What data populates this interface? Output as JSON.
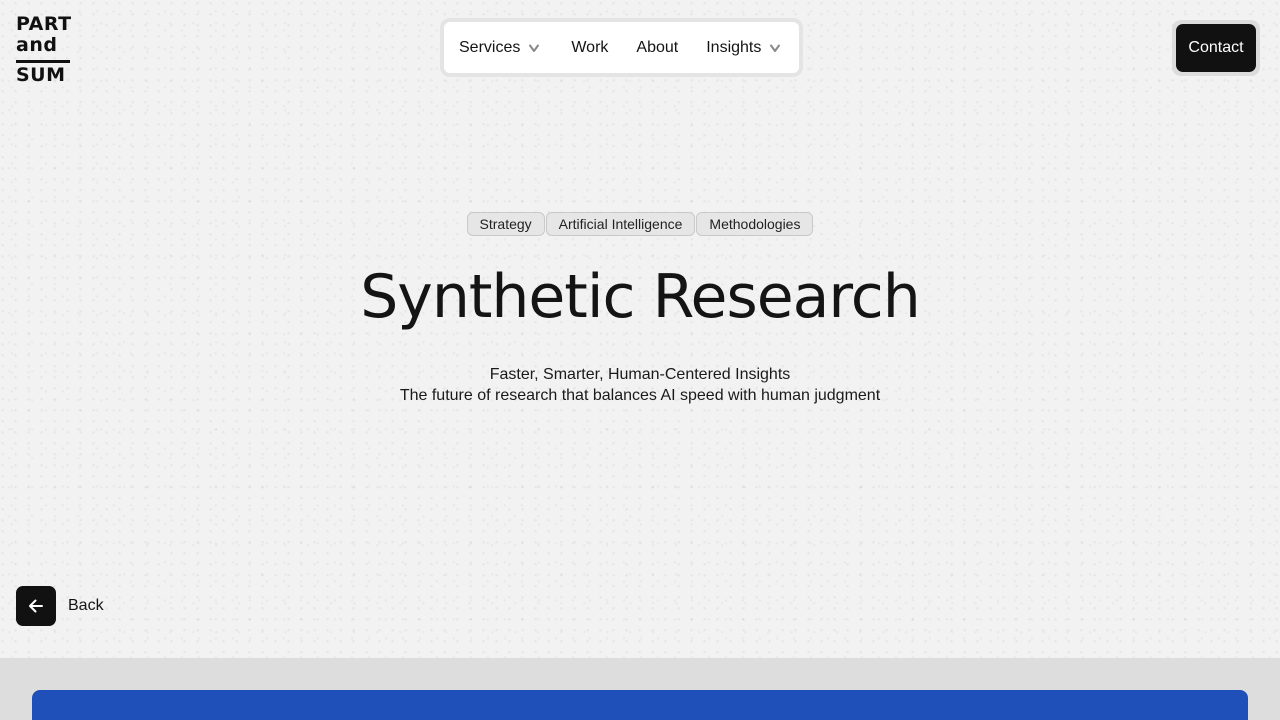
{
  "logo": {
    "line1": "PART",
    "line2": "and",
    "line3": "SUM"
  },
  "nav": {
    "items": [
      {
        "label": "Services",
        "has_dropdown": true,
        "icon": "chevron-down-icon"
      },
      {
        "label": "Work",
        "has_dropdown": false
      },
      {
        "label": "About",
        "has_dropdown": false
      },
      {
        "label": "Insights",
        "has_dropdown": true,
        "icon": "chevron-down-icon"
      }
    ]
  },
  "contact": {
    "label": "Contact"
  },
  "tags": [
    "Strategy",
    "Artificial Intelligence",
    "Methodologies"
  ],
  "hero": {
    "title": "Synthetic Research",
    "subtitle_line1": "Faster, Smarter, Human-Centered Insights",
    "subtitle_line2": "The future of research that balances AI speed with human judgment"
  },
  "back": {
    "label": "Back",
    "icon": "arrow-left-icon"
  },
  "colors": {
    "background": "#f2f2f2",
    "primary_dark": "#111111",
    "accent_blue": "#1f4fb9"
  }
}
